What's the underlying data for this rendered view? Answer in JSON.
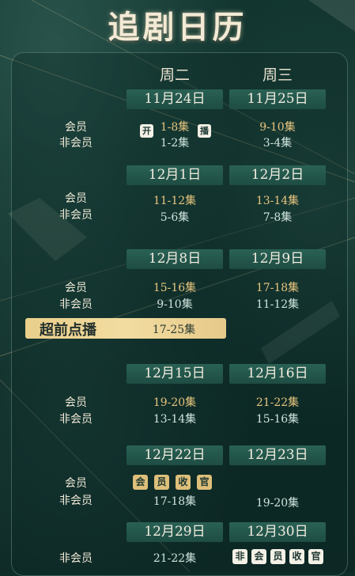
{
  "title": "追剧日历",
  "weekdays": [
    "周二",
    "周三"
  ],
  "labels": {
    "member": "会员",
    "non_member": "非会员"
  },
  "badges": {
    "open": "开",
    "air": "播"
  },
  "weeks": [
    {
      "tue_date": "11月24日",
      "wed_date": "11月25日",
      "tue_member": "1-8集",
      "tue_nonmember": "1-2集",
      "wed_member": "9-10集",
      "wed_nonmember": "3-4集"
    },
    {
      "tue_date": "12月1日",
      "wed_date": "12月2日",
      "tue_member": "11-12集",
      "tue_nonmember": "5-6集",
      "wed_member": "13-14集",
      "wed_nonmember": "7-8集"
    },
    {
      "tue_date": "12月8日",
      "wed_date": "12月9日",
      "tue_member": "15-16集",
      "tue_nonmember": "9-10集",
      "wed_member": "17-18集",
      "wed_nonmember": "11-12集"
    },
    {
      "tue_date": "12月15日",
      "wed_date": "12月16日",
      "tue_member": "19-20集",
      "tue_nonmember": "13-14集",
      "wed_member": "21-22集",
      "wed_nonmember": "15-16集"
    },
    {
      "tue_date": "12月22日",
      "wed_date": "12月23日",
      "tue_nonmember": "17-18集",
      "wed_nonmember": "19-20集"
    },
    {
      "tue_date": "12月29日",
      "wed_date": "12月30日",
      "tue_nonmember": "21-22集"
    }
  ],
  "advance": {
    "label": "超前点播",
    "episodes": "17-25集"
  },
  "member_finale": [
    "会",
    "员",
    "收",
    "官"
  ],
  "nonmember_finale": [
    "非",
    "会",
    "员",
    "收",
    "官"
  ],
  "colors": {
    "gold": "#e6c47d",
    "cream": "#cfe3dc",
    "date_box": "#245a4e",
    "background": "#0f2e2a"
  }
}
